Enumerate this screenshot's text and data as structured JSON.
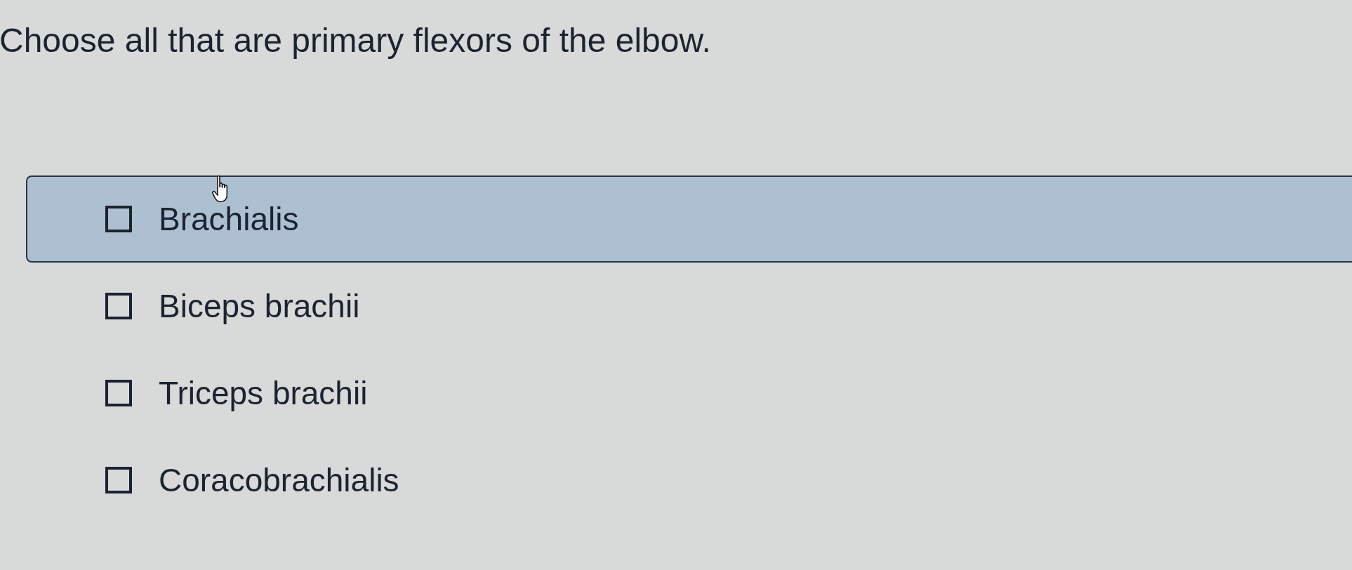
{
  "question": "Choose all that are primary flexors of the elbow.",
  "options": [
    {
      "label": "Brachialis",
      "checked": false,
      "hovered": true
    },
    {
      "label": "Biceps brachii",
      "checked": false,
      "hovered": false
    },
    {
      "label": "Triceps brachii",
      "checked": false,
      "hovered": false
    },
    {
      "label": "Coracobrachialis",
      "checked": false,
      "hovered": false
    }
  ]
}
